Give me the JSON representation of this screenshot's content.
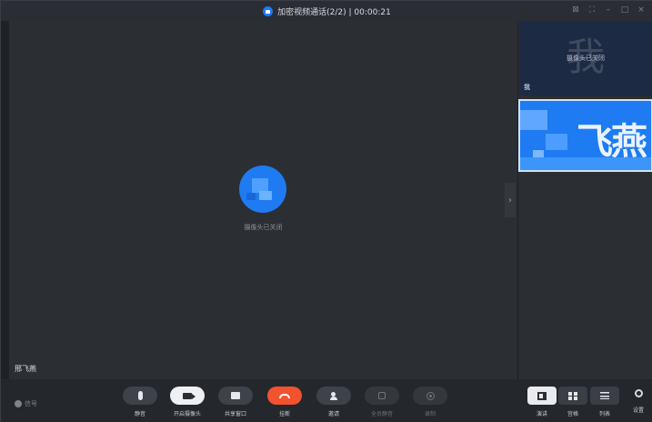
{
  "titlebar": {
    "title": "加密视频通话(2/2) | 00:00:21",
    "controls": [
      "⊠",
      "⛶",
      "–",
      "□",
      "×"
    ]
  },
  "main_video": {
    "camera_off_text": "摄像头已关闭",
    "participant_name": "邢飞燕"
  },
  "right_panel": {
    "self_tile": {
      "big_char": "我",
      "camera_off_text": "摄像头已关闭",
      "label": "我"
    },
    "other_tile": {
      "big_char": "飞燕"
    }
  },
  "toolbar": {
    "signal_text": "信号",
    "buttons": [
      {
        "label": "静音",
        "icon": "mic-icon"
      },
      {
        "label": "开启摄像头",
        "icon": "camera-icon"
      },
      {
        "label": "共享窗口",
        "icon": "screen-share-icon"
      },
      {
        "label": "挂断",
        "icon": "hang-up-icon"
      },
      {
        "label": "邀请",
        "icon": "invite-icon"
      },
      {
        "label": "全员静音",
        "icon": "mute-all-icon"
      },
      {
        "label": "录制",
        "icon": "record-icon"
      }
    ],
    "layouts": [
      {
        "label": "演讲",
        "icon": "speaker-layout-icon"
      },
      {
        "label": "宫格",
        "icon": "grid-layout-icon"
      },
      {
        "label": "列表",
        "icon": "list-layout-icon"
      }
    ],
    "settings_label": "设置"
  },
  "colors": {
    "accent": "#1e7bf2",
    "hangup": "#f2522e",
    "background": "#1f2126"
  }
}
